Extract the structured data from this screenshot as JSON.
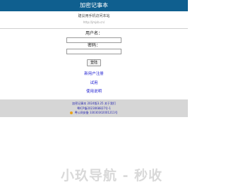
{
  "header": {
    "title": "加密记事本"
  },
  "intro": {
    "subtitle": "建议用手机访问本站",
    "url": "http://jmjsb.cn/"
  },
  "login_form": {
    "username_label": "用户名：",
    "username_value": "",
    "password_label": "密码：",
    "password_value": "",
    "login_button_label": "登陆"
  },
  "links": {
    "register": "新用户注册",
    "trial": "试用",
    "help": "使用说明"
  },
  "footer": {
    "line1_name": "加密记事本",
    "line1_version": "2024版3.25",
    "line1_about": "关于我们",
    "line2": "粤ICP备2023068827号-1",
    "line3": "粤公网安备 33030302001211号",
    "police_badge_icon": "police-badge-icon"
  },
  "watermark": {
    "text": "小玖导航 - 秒收"
  },
  "colors": {
    "title_bar": "#0f5f8f",
    "link": "#1a1ad0",
    "footer_bg": "#d6d6d6"
  }
}
